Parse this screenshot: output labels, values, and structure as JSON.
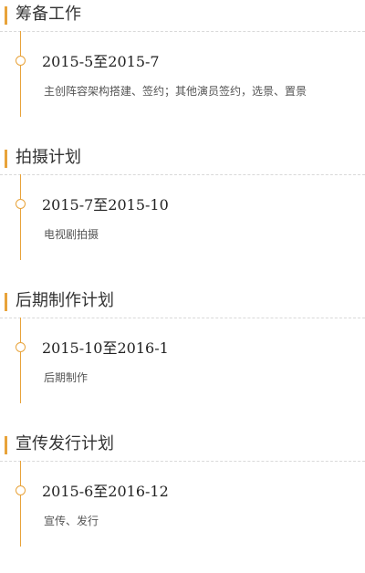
{
  "sections": [
    {
      "title": "筹备工作",
      "date": "2015-5至2015-7",
      "desc": "主创阵容架构搭建、签约；其他演员签约，选景、置景"
    },
    {
      "title": "拍摄计划",
      "date": "2015-7至2015-10",
      "desc": "电视剧拍摄"
    },
    {
      "title": "后期制作计划",
      "date": "2015-10至2016-1",
      "desc": "后期制作"
    },
    {
      "title": "宣传发行计划",
      "date": "2015-6至2016-12",
      "desc": "宣传、发行"
    }
  ],
  "colors": {
    "accent": "#e8a33a",
    "divider": "#d9d9d9"
  }
}
